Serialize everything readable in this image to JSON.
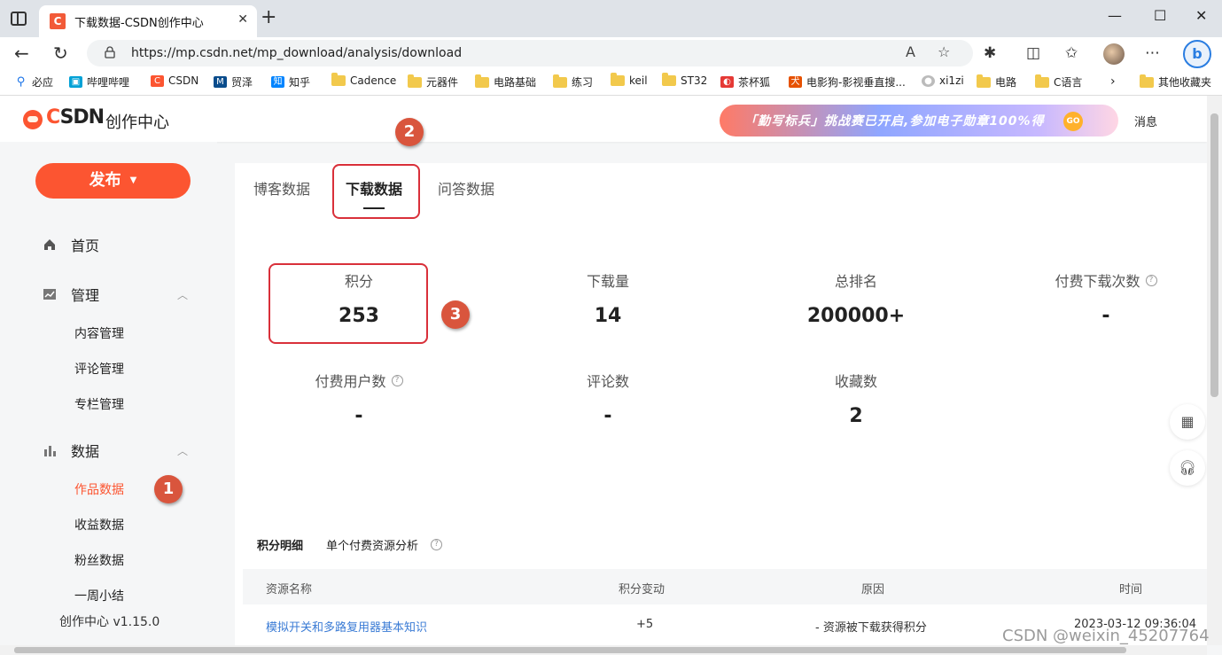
{
  "browser": {
    "tab_title": "下载数据-CSDN创作中心",
    "tab_favicon": "C",
    "new_tab": "+",
    "url": "https://mp.csdn.net/mp_download/analysis/download",
    "window_controls": [
      "—",
      "☐",
      "✕"
    ]
  },
  "bookmarks": [
    {
      "label": "必应",
      "icon": "search-icon",
      "color": "#1a73e8"
    },
    {
      "label": "哔哩哔哩",
      "icon": "bilibili-icon",
      "color": "#00a1d6"
    },
    {
      "label": "CSDN",
      "icon": "csdn-icon",
      "color": "#fc5531"
    },
    {
      "label": "贸泽",
      "icon": "mouser-icon",
      "color": "#0a4c8c"
    },
    {
      "label": "知乎",
      "icon": "zhihu-icon",
      "color": "#0084ff"
    },
    {
      "label": "Cadence",
      "icon": "folder-icon"
    },
    {
      "label": "元器件",
      "icon": "folder-icon"
    },
    {
      "label": "电路基础",
      "icon": "folder-icon"
    },
    {
      "label": "练习",
      "icon": "folder-icon"
    },
    {
      "label": "keil",
      "icon": "folder-icon"
    },
    {
      "label": "ST32",
      "icon": "folder-icon"
    },
    {
      "label": "茶杯狐",
      "icon": "cupfox-icon",
      "color": "#e53935"
    },
    {
      "label": "电影狗-影视垂直搜...",
      "icon": "dog-icon",
      "color": "#e65100"
    },
    {
      "label": "xi1zi",
      "icon": "user-icon",
      "color": "#bbbbbb"
    },
    {
      "label": "电路",
      "icon": "folder-icon"
    },
    {
      "label": "C语言",
      "icon": "folder-icon"
    },
    {
      "label": "其他收藏夹",
      "icon": "folder-icon"
    }
  ],
  "header": {
    "logo_c": "C",
    "logo_rest": "SDN",
    "subtitle": "创作中心",
    "banner_text": "「勤写标兵」挑战赛已开启,参加电子勋章100%得",
    "banner_go": "GO",
    "messages": "消息"
  },
  "sidebar": {
    "publish": "发布",
    "home": "首页",
    "manage": "管理",
    "manage_items": [
      "内容管理",
      "评论管理",
      "专栏管理"
    ],
    "data": "数据",
    "data_items": [
      "作品数据",
      "收益数据",
      "粉丝数据",
      "一周小结"
    ],
    "version": "创作中心 v1.15.0"
  },
  "tabs": [
    "博客数据",
    "下载数据",
    "问答数据"
  ],
  "stats": [
    {
      "label": "积分",
      "value": "253",
      "help": false
    },
    {
      "label": "下载量",
      "value": "14",
      "help": false
    },
    {
      "label": "总排名",
      "value": "200000+",
      "help": false
    },
    {
      "label": "付费下载次数",
      "value": "-",
      "help": true
    },
    {
      "label": "付费用户数",
      "value": "-",
      "help": true
    },
    {
      "label": "评论数",
      "value": "-",
      "help": false
    },
    {
      "label": "收藏数",
      "value": "2",
      "help": false
    }
  ],
  "detail_tabs": [
    "积分明细",
    "单个付费资源分析"
  ],
  "table": {
    "headers": [
      "资源名称",
      "积分变动",
      "原因",
      "时间"
    ],
    "rows": [
      [
        "模拟开关和多路复用器基本知识",
        "+5",
        "- 资源被下载获得积分",
        "2023-03-12 09:36:04"
      ]
    ]
  },
  "markers": [
    "1",
    "2",
    "3"
  ],
  "watermark": "CSDN @weixin_45207764",
  "colors": {
    "accent": "#fc5531",
    "link": "#3a7bd5",
    "annotation": "#d9553d"
  }
}
